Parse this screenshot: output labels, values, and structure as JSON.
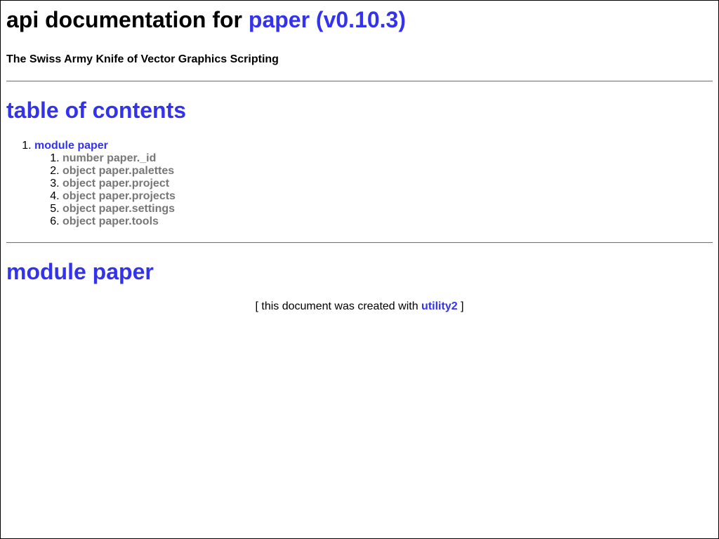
{
  "header": {
    "title_prefix": "api documentation for",
    "title_link": "paper (v0.10.3)",
    "tagline": "The Swiss Army Knife of Vector Graphics Scripting"
  },
  "toc": {
    "heading": "table of contents",
    "module": {
      "label": "module paper",
      "items": [
        "number paper._id",
        "object paper.palettes",
        "object paper.project",
        "object paper.projects",
        "object paper.settings",
        "object paper.tools"
      ]
    }
  },
  "module_section": {
    "heading": "module paper"
  },
  "footer": {
    "prefix": "[ this document was created with",
    "link": "utility2",
    "suffix": "]"
  },
  "colors": {
    "accent": "#3333ee",
    "muted_link": "#777777",
    "text": "#000000",
    "background": "#ffffff"
  }
}
